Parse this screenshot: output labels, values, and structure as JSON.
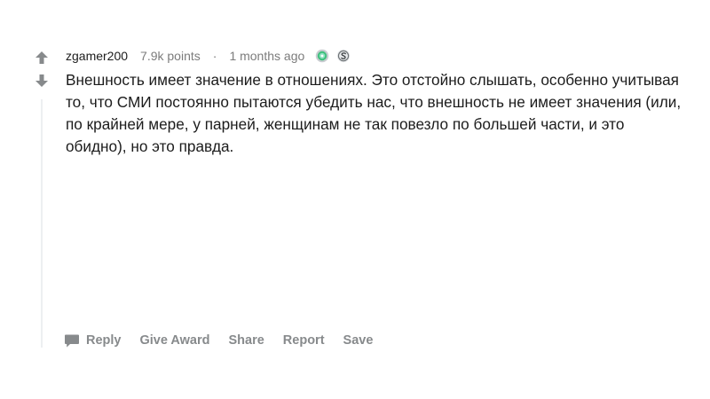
{
  "comment": {
    "author": "zgamer200",
    "points": "7.9k points",
    "separator": "·",
    "time": "1 months ago",
    "awards": [
      "silver-award-icon",
      "coin-award-icon"
    ],
    "body": "Внешность имеет значение в отношениях. Это отстойно слышать, особенно учитывая то, что СМИ постоянно пытаются убедить нас, что внешность не имеет значения (или, по крайней мере, у парней, женщинам не так повезло по большей части, и это обидно), но это правда."
  },
  "actions": {
    "reply": "Reply",
    "give_award": "Give Award",
    "share": "Share",
    "report": "Report",
    "save": "Save"
  },
  "colors": {
    "text": "#1c1c1c",
    "meta": "#7c7c7c",
    "action": "#878a8c",
    "thread_line": "#edeff1"
  }
}
